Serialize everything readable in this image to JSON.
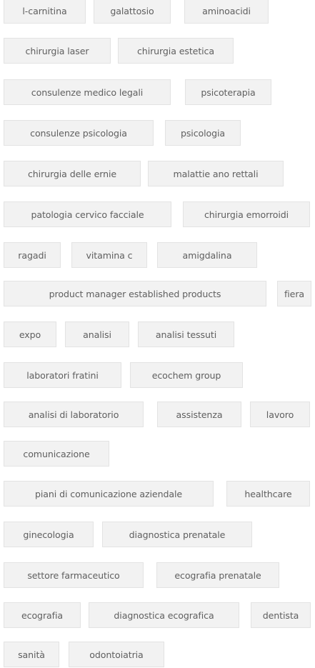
{
  "tags": [
    "l-carnitina",
    "galattosio",
    "aminoacidi",
    "chirurgia laser",
    "chirurgia estetica",
    "consulenze medico legali",
    "psicoterapia",
    "consulenze psicologia",
    "psicologia",
    "chirurgia delle ernie",
    "malattie ano rettali",
    "patologia cervico facciale",
    "chirurgia emorroidi",
    "ragadi",
    "vitamina c",
    "amigdalina",
    "product manager established products",
    "fiera",
    "expo",
    "analisi",
    "analisi tessuti",
    "laboratori fratini",
    "ecochem group",
    "analisi di laboratorio",
    "assistenza",
    "lavoro",
    "comunicazione",
    "piani di comunicazione aziendale",
    "healthcare",
    "ginecologia",
    "diagnostica prenatale",
    "settore farmaceutico",
    "ecografia prenatale",
    "ecografia",
    "diagnostica ecografica",
    "dentista",
    "sanità",
    "odontoiatria"
  ]
}
